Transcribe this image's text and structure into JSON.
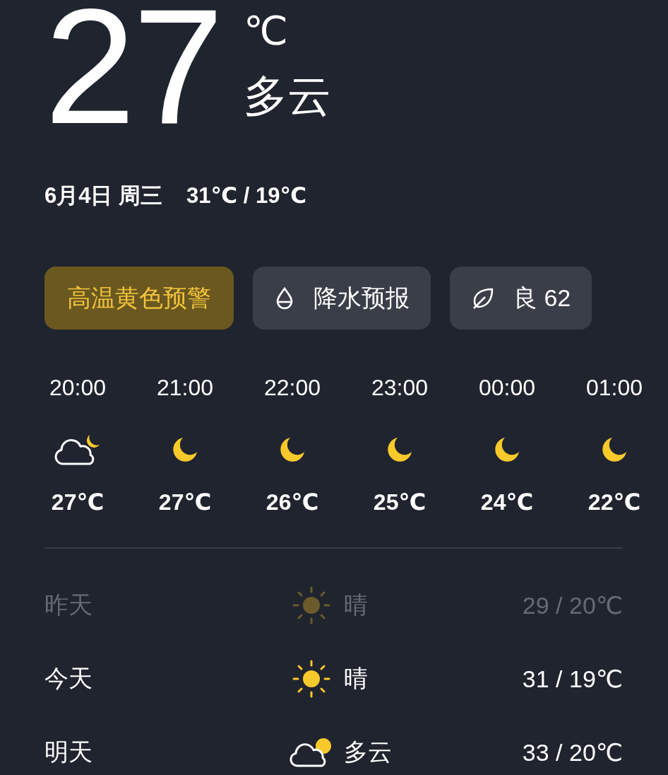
{
  "current": {
    "temperature": "27",
    "unit": "℃",
    "condition": "多云"
  },
  "date_line": {
    "date": "6月4日 周三",
    "range": "31℃ / 19℃"
  },
  "chips": [
    {
      "kind": "warning",
      "label": "高温黄色预警"
    },
    {
      "kind": "rain",
      "label": "降水预报"
    },
    {
      "kind": "air",
      "label": "良 62"
    }
  ],
  "hourly": [
    {
      "time": "20:00",
      "kind": "cloud-moon",
      "temp": "27℃"
    },
    {
      "time": "21:00",
      "kind": "moon",
      "temp": "27℃"
    },
    {
      "time": "22:00",
      "kind": "moon",
      "temp": "26℃"
    },
    {
      "time": "23:00",
      "kind": "moon",
      "temp": "25℃"
    },
    {
      "time": "00:00",
      "kind": "moon",
      "temp": "24℃"
    },
    {
      "time": "01:00",
      "kind": "moon",
      "temp": "22℃"
    }
  ],
  "daily": [
    {
      "day": "昨天",
      "kind": "sun",
      "condition": "晴",
      "temps": "29 / 20℃",
      "past": true
    },
    {
      "day": "今天",
      "kind": "sun",
      "condition": "晴",
      "temps": "31 / 19℃",
      "past": false
    },
    {
      "day": "明天",
      "kind": "cloud-sun",
      "condition": "多云",
      "temps": "33 / 20℃",
      "past": false
    }
  ]
}
